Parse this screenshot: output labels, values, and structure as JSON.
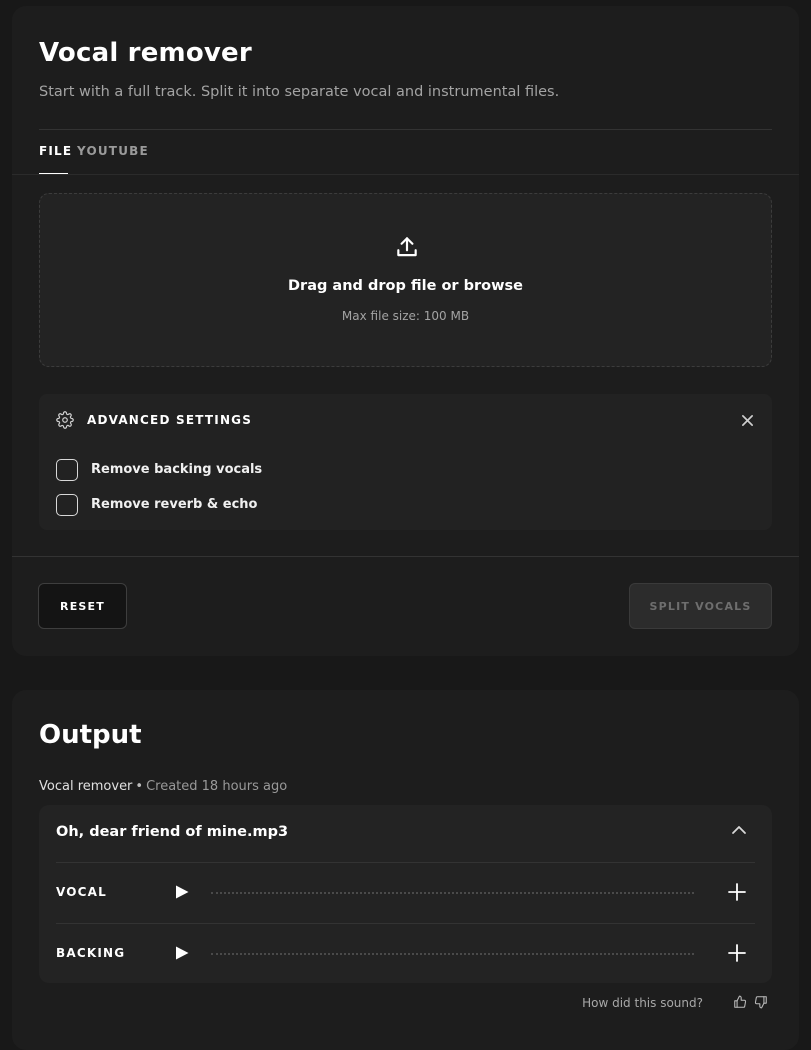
{
  "vocal_remover": {
    "title": "Vocal remover",
    "subtitle": "Start with a full track. Split it into separate vocal and instrumental files.",
    "tabs": [
      {
        "label": "FILE",
        "active": true
      },
      {
        "label": "YOUTUBE",
        "active": false
      }
    ],
    "dropzone": {
      "label": "Drag and drop file or browse",
      "max_size": "Max file size: 100 MB",
      "icon": "upload-icon"
    },
    "advanced_settings": {
      "title": "ADVANCED SETTINGS",
      "icon": "gear-icon",
      "options": [
        {
          "label": "Remove backing vocals",
          "checked": false
        },
        {
          "label": "Remove reverb & echo",
          "checked": false
        }
      ]
    },
    "buttons": {
      "reset": "RESET",
      "split": "SPLIT VOCALS",
      "split_disabled": true
    }
  },
  "output": {
    "title": "Output",
    "source": "Vocal remover",
    "created": "Created 18 hours ago",
    "file": {
      "name": "Oh, dear friend of mine.mp3",
      "expanded": true,
      "tracks": [
        {
          "label": "VOCAL"
        },
        {
          "label": "BACKING"
        }
      ]
    },
    "feedback": "How did this sound?"
  },
  "colors": {
    "background": "#181818",
    "card": "#1d1d1d",
    "panel": "#232323",
    "text": "#ffffff",
    "muted": "#a3a3a3"
  }
}
